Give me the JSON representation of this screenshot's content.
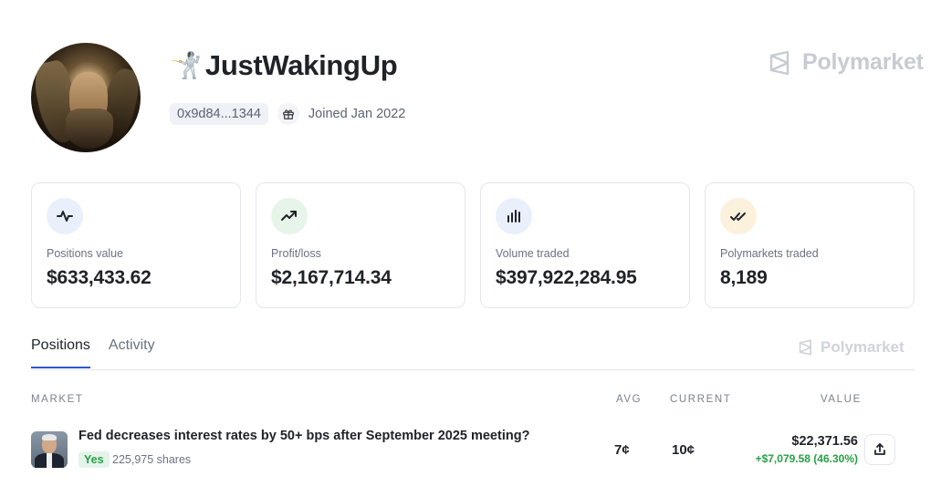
{
  "profile": {
    "emoji": "🤺",
    "username": "JustWakingUp",
    "address": "0x9d84...1344",
    "joined": "Joined Jan 2022"
  },
  "brand": {
    "name": "Polymarket"
  },
  "stats": [
    {
      "icon": "activity-icon",
      "label": "Positions value",
      "value": "$633,433.62"
    },
    {
      "icon": "trending-up-icon",
      "label": "Profit/loss",
      "value": "$2,167,714.34"
    },
    {
      "icon": "bar-chart-icon",
      "label": "Volume traded",
      "value": "$397,922,284.95"
    },
    {
      "icon": "double-check-icon",
      "label": "Polymarkets traded",
      "value": "8,189"
    }
  ],
  "tabs": [
    {
      "label": "Positions",
      "active": true
    },
    {
      "label": "Activity",
      "active": false
    }
  ],
  "table": {
    "headers": {
      "market": "MARKET",
      "avg": "AVG",
      "current": "CURRENT",
      "value": "VALUE"
    },
    "rows": [
      {
        "title": "Fed decreases interest rates by 50+ bps after September 2025 meeting?",
        "outcome": "Yes",
        "shares": "225,975 shares",
        "avg": "7¢",
        "current": "10¢",
        "value": "$22,371.56",
        "pnl": "+$7,079.58 (46.30%)"
      }
    ]
  },
  "colors": {
    "accent": "#2f55d4",
    "positive": "#27a046",
    "brand_muted": "#c7ccd3"
  }
}
